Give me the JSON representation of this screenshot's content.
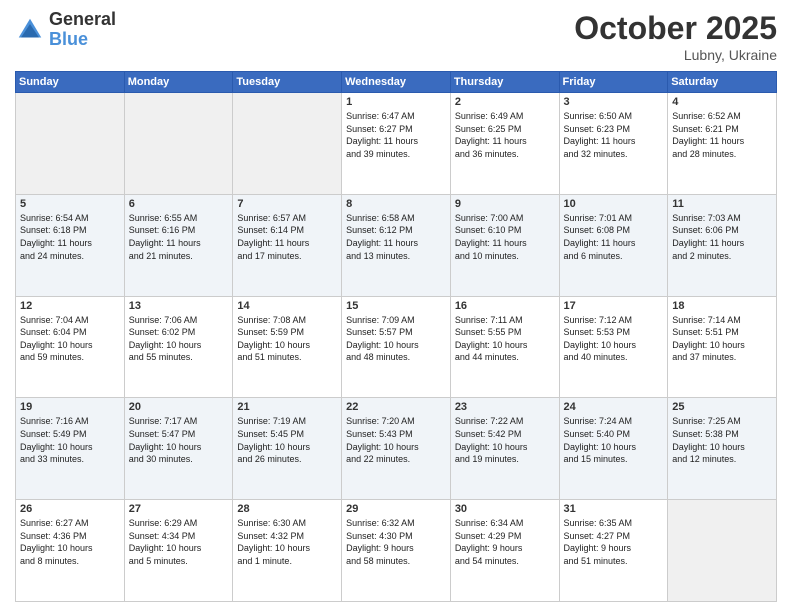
{
  "header": {
    "logo_general": "General",
    "logo_blue": "Blue",
    "month": "October 2025",
    "location": "Lubny, Ukraine"
  },
  "weekdays": [
    "Sunday",
    "Monday",
    "Tuesday",
    "Wednesday",
    "Thursday",
    "Friday",
    "Saturday"
  ],
  "weeks": [
    [
      {
        "day": "",
        "info": ""
      },
      {
        "day": "",
        "info": ""
      },
      {
        "day": "",
        "info": ""
      },
      {
        "day": "1",
        "info": "Sunrise: 6:47 AM\nSunset: 6:27 PM\nDaylight: 11 hours\nand 39 minutes."
      },
      {
        "day": "2",
        "info": "Sunrise: 6:49 AM\nSunset: 6:25 PM\nDaylight: 11 hours\nand 36 minutes."
      },
      {
        "day": "3",
        "info": "Sunrise: 6:50 AM\nSunset: 6:23 PM\nDaylight: 11 hours\nand 32 minutes."
      },
      {
        "day": "4",
        "info": "Sunrise: 6:52 AM\nSunset: 6:21 PM\nDaylight: 11 hours\nand 28 minutes."
      }
    ],
    [
      {
        "day": "5",
        "info": "Sunrise: 6:54 AM\nSunset: 6:18 PM\nDaylight: 11 hours\nand 24 minutes."
      },
      {
        "day": "6",
        "info": "Sunrise: 6:55 AM\nSunset: 6:16 PM\nDaylight: 11 hours\nand 21 minutes."
      },
      {
        "day": "7",
        "info": "Sunrise: 6:57 AM\nSunset: 6:14 PM\nDaylight: 11 hours\nand 17 minutes."
      },
      {
        "day": "8",
        "info": "Sunrise: 6:58 AM\nSunset: 6:12 PM\nDaylight: 11 hours\nand 13 minutes."
      },
      {
        "day": "9",
        "info": "Sunrise: 7:00 AM\nSunset: 6:10 PM\nDaylight: 11 hours\nand 10 minutes."
      },
      {
        "day": "10",
        "info": "Sunrise: 7:01 AM\nSunset: 6:08 PM\nDaylight: 11 hours\nand 6 minutes."
      },
      {
        "day": "11",
        "info": "Sunrise: 7:03 AM\nSunset: 6:06 PM\nDaylight: 11 hours\nand 2 minutes."
      }
    ],
    [
      {
        "day": "12",
        "info": "Sunrise: 7:04 AM\nSunset: 6:04 PM\nDaylight: 10 hours\nand 59 minutes."
      },
      {
        "day": "13",
        "info": "Sunrise: 7:06 AM\nSunset: 6:02 PM\nDaylight: 10 hours\nand 55 minutes."
      },
      {
        "day": "14",
        "info": "Sunrise: 7:08 AM\nSunset: 5:59 PM\nDaylight: 10 hours\nand 51 minutes."
      },
      {
        "day": "15",
        "info": "Sunrise: 7:09 AM\nSunset: 5:57 PM\nDaylight: 10 hours\nand 48 minutes."
      },
      {
        "day": "16",
        "info": "Sunrise: 7:11 AM\nSunset: 5:55 PM\nDaylight: 10 hours\nand 44 minutes."
      },
      {
        "day": "17",
        "info": "Sunrise: 7:12 AM\nSunset: 5:53 PM\nDaylight: 10 hours\nand 40 minutes."
      },
      {
        "day": "18",
        "info": "Sunrise: 7:14 AM\nSunset: 5:51 PM\nDaylight: 10 hours\nand 37 minutes."
      }
    ],
    [
      {
        "day": "19",
        "info": "Sunrise: 7:16 AM\nSunset: 5:49 PM\nDaylight: 10 hours\nand 33 minutes."
      },
      {
        "day": "20",
        "info": "Sunrise: 7:17 AM\nSunset: 5:47 PM\nDaylight: 10 hours\nand 30 minutes."
      },
      {
        "day": "21",
        "info": "Sunrise: 7:19 AM\nSunset: 5:45 PM\nDaylight: 10 hours\nand 26 minutes."
      },
      {
        "day": "22",
        "info": "Sunrise: 7:20 AM\nSunset: 5:43 PM\nDaylight: 10 hours\nand 22 minutes."
      },
      {
        "day": "23",
        "info": "Sunrise: 7:22 AM\nSunset: 5:42 PM\nDaylight: 10 hours\nand 19 minutes."
      },
      {
        "day": "24",
        "info": "Sunrise: 7:24 AM\nSunset: 5:40 PM\nDaylight: 10 hours\nand 15 minutes."
      },
      {
        "day": "25",
        "info": "Sunrise: 7:25 AM\nSunset: 5:38 PM\nDaylight: 10 hours\nand 12 minutes."
      }
    ],
    [
      {
        "day": "26",
        "info": "Sunrise: 6:27 AM\nSunset: 4:36 PM\nDaylight: 10 hours\nand 8 minutes."
      },
      {
        "day": "27",
        "info": "Sunrise: 6:29 AM\nSunset: 4:34 PM\nDaylight: 10 hours\nand 5 minutes."
      },
      {
        "day": "28",
        "info": "Sunrise: 6:30 AM\nSunset: 4:32 PM\nDaylight: 10 hours\nand 1 minute."
      },
      {
        "day": "29",
        "info": "Sunrise: 6:32 AM\nSunset: 4:30 PM\nDaylight: 9 hours\nand 58 minutes."
      },
      {
        "day": "30",
        "info": "Sunrise: 6:34 AM\nSunset: 4:29 PM\nDaylight: 9 hours\nand 54 minutes."
      },
      {
        "day": "31",
        "info": "Sunrise: 6:35 AM\nSunset: 4:27 PM\nDaylight: 9 hours\nand 51 minutes."
      },
      {
        "day": "",
        "info": ""
      }
    ]
  ]
}
